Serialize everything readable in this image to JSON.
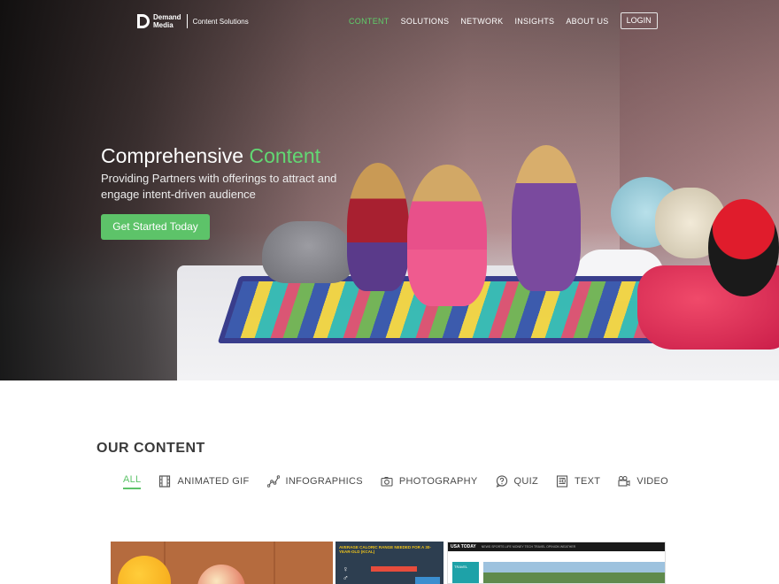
{
  "brand": {
    "name_line1": "Demand",
    "name_line2": "Media",
    "sub": "Content Solutions"
  },
  "nav": {
    "items": [
      {
        "label": "CONTENT",
        "active": true
      },
      {
        "label": "SOLUTIONS",
        "active": false
      },
      {
        "label": "NETWORK",
        "active": false
      },
      {
        "label": "INSIGHTS",
        "active": false
      },
      {
        "label": "ABOUT US",
        "active": false
      }
    ],
    "login": "LOGIN"
  },
  "hero": {
    "title_plain": "Comprehensive ",
    "title_accent": "Content",
    "subtitle": "Providing Partners with offerings to attract and engage intent-driven audience",
    "cta": "Get Started Today"
  },
  "content_section": {
    "title": "OUR CONTENT",
    "filters": [
      {
        "label": "ALL",
        "icon": "none",
        "active": true
      },
      {
        "label": "ANIMATED GIF",
        "icon": "film-icon",
        "active": false
      },
      {
        "label": "INFOGRAPHICS",
        "icon": "graph-icon",
        "active": false
      },
      {
        "label": "PHOTOGRAPHY",
        "icon": "camera-icon",
        "active": false
      },
      {
        "label": "QUIZ",
        "icon": "question-bubble-icon",
        "active": false
      },
      {
        "label": "TEXT",
        "icon": "document-icon",
        "active": false
      },
      {
        "label": "VIDEO",
        "icon": "video-camera-icon",
        "active": false
      }
    ]
  },
  "thumbnails": {
    "infographic_heading": "AVERAGE CALORIC RANGE NEEDED FOR A 30-YEAR-OLD (KCAL)",
    "news_logo": "USA TODAY",
    "news_nav": "NEWS  SPORTS  LIFE  MONEY  TECH  TRAVEL  OPINION  WEATHER",
    "news_side": "TRAVEL"
  },
  "colors": {
    "accent_green": "#5dc369",
    "nav_active": "#5fcf6a",
    "section_text": "#3a3a3a"
  }
}
